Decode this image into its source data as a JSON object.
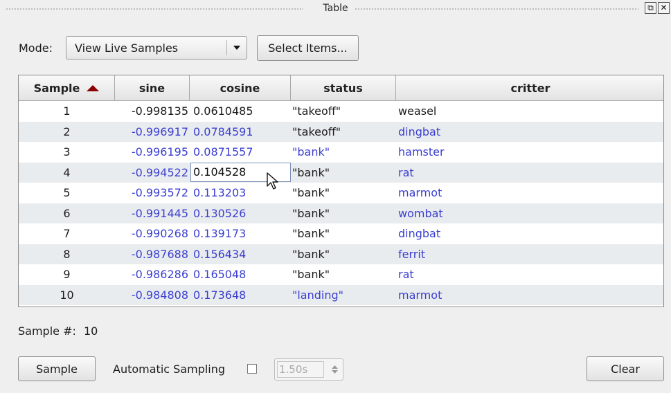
{
  "window": {
    "title": "Table"
  },
  "mode": {
    "label": "Mode:",
    "selected": "View Live Samples",
    "select_items_label": "Select Items..."
  },
  "table": {
    "columns": [
      "Sample",
      "sine",
      "cosine",
      "status",
      "critter"
    ],
    "sorted_by": "Sample",
    "rows": [
      [
        "1",
        "-0.998135",
        "0.0610485",
        "\"takeoff\"",
        "weasel"
      ],
      [
        "2",
        "-0.996917",
        "0.0784591",
        "\"takeoff\"",
        "dingbat"
      ],
      [
        "3",
        "-0.996195",
        "0.0871557",
        "\"bank\"",
        "hamster"
      ],
      [
        "4",
        "-0.994522",
        "0.104528",
        "\"bank\"",
        "rat"
      ],
      [
        "5",
        "-0.993572",
        "0.113203",
        "\"bank\"",
        "marmot"
      ],
      [
        "6",
        "-0.991445",
        "0.130526",
        "\"bank\"",
        "wombat"
      ],
      [
        "7",
        "-0.990268",
        "0.139173",
        "\"bank\"",
        "dingbat"
      ],
      [
        "8",
        "-0.987688",
        "0.156434",
        "\"bank\"",
        "ferrit"
      ],
      [
        "9",
        "-0.986286",
        "0.165048",
        "\"bank\"",
        "rat"
      ],
      [
        "10",
        "-0.984808",
        "0.173648",
        "\"landing\"",
        "marmot"
      ]
    ]
  },
  "footer": {
    "sample_count_label": "Sample #:",
    "sample_count": "10",
    "sample_button": "Sample",
    "auto_sampling_label": "Automatic Sampling",
    "interval": "1.50s",
    "clear_button": "Clear"
  },
  "colors": {
    "changed_value": "#3a3ed0",
    "sort_arrow": "#8b0000"
  }
}
